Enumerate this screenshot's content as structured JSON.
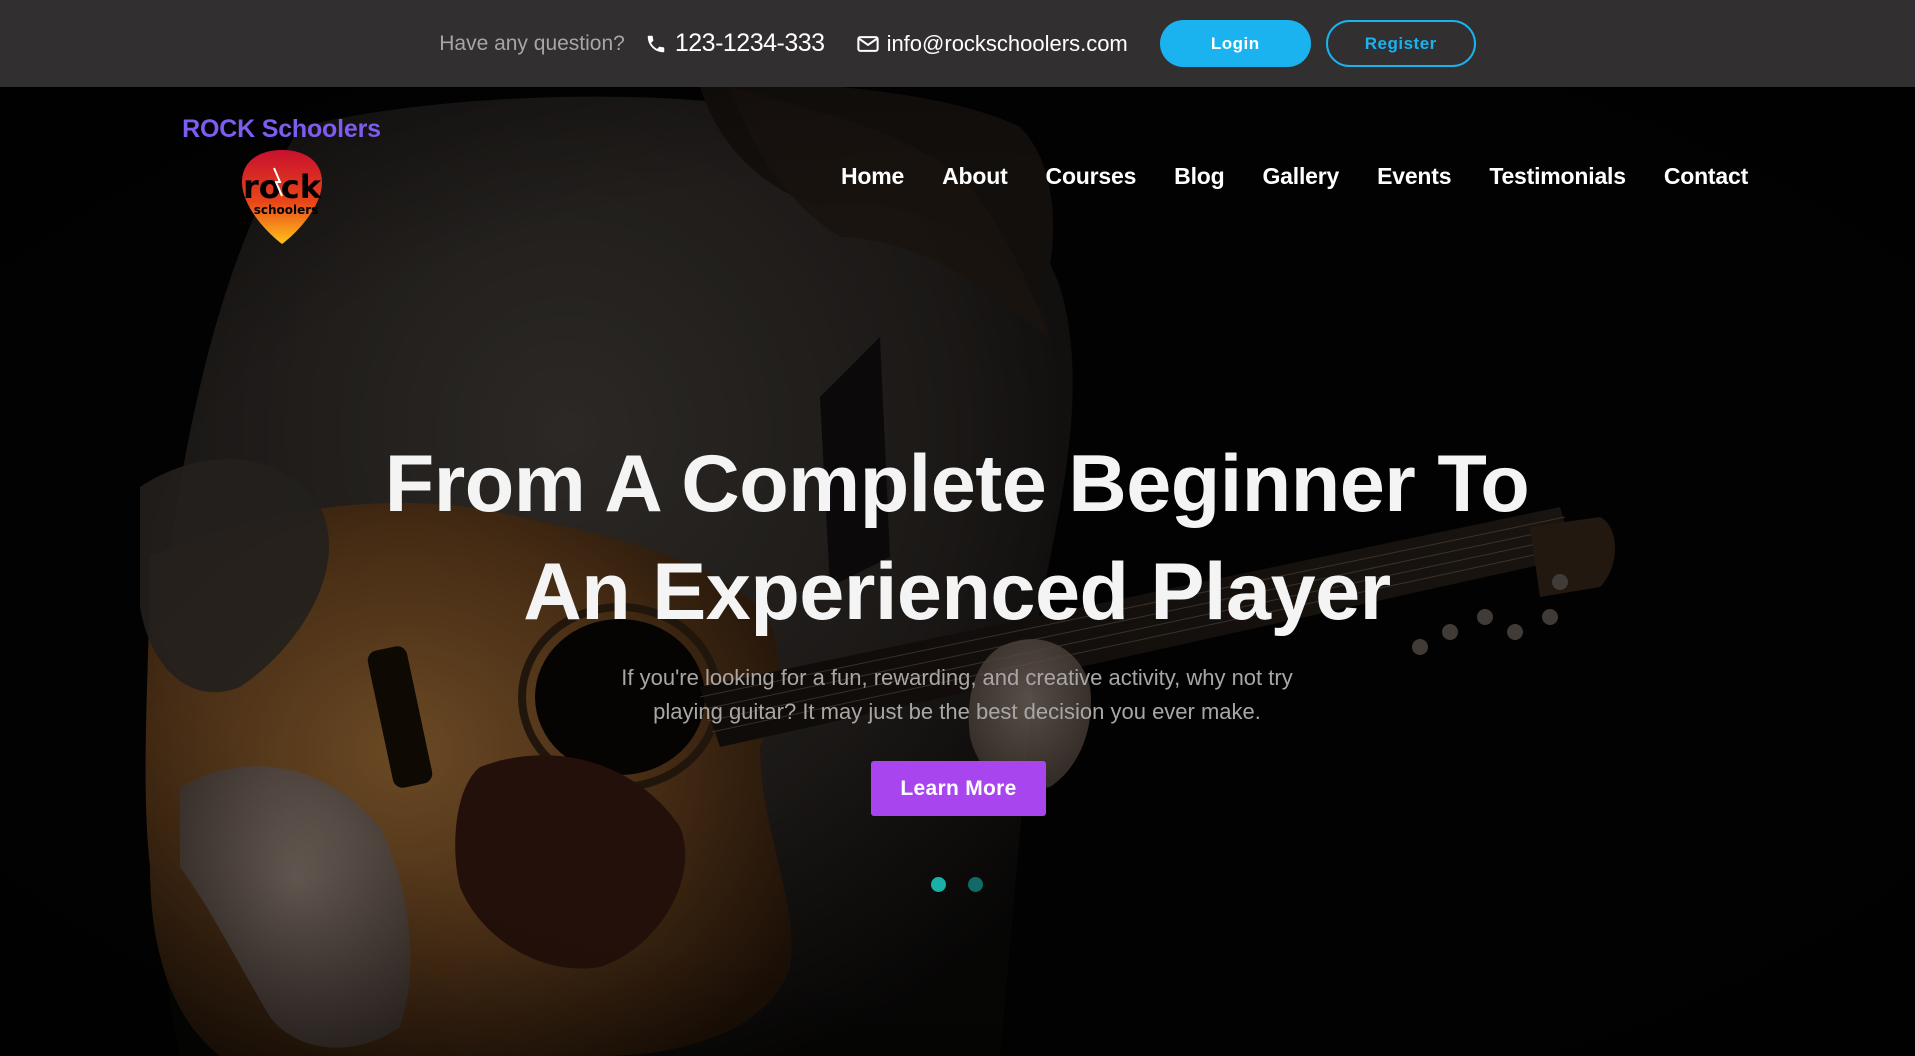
{
  "topbar": {
    "question": "Have any question?",
    "phone": "123-1234-333",
    "email": "info@rockschoolers.com",
    "login_label": "Login",
    "register_label": "Register",
    "phone_icon": "phone-icon",
    "email_icon": "envelope-icon"
  },
  "brand": {
    "name": "ROCK Schoolers",
    "logo_word": "rock",
    "logo_sub": "schoolers"
  },
  "nav": {
    "items": [
      {
        "label": "Home"
      },
      {
        "label": "About"
      },
      {
        "label": "Courses"
      },
      {
        "label": "Blog"
      },
      {
        "label": "Gallery"
      },
      {
        "label": "Events"
      },
      {
        "label": "Testimonials"
      },
      {
        "label": "Contact"
      }
    ]
  },
  "hero": {
    "title_line1": "From A Complete Beginner To",
    "title_line2": "An Experienced Player",
    "subtitle_line1": "If you're looking for a fun, rewarding, and creative activity, why not try",
    "subtitle_line2": "playing guitar? It may just be the best decision you ever make.",
    "cta_label": "Learn More",
    "slides": 2,
    "active_slide": 1
  },
  "colors": {
    "topbar_bg": "#322f30",
    "accent_blue": "#1ab3f0",
    "cta_purple": "#a845ef",
    "brand_purple": "#7d5cf0",
    "dot_active": "#1ab0a8"
  }
}
